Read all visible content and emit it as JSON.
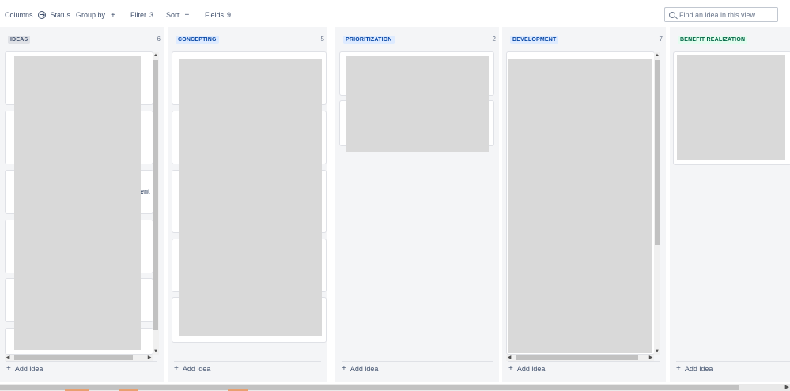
{
  "toolbar": {
    "columns_label": "Columns",
    "columns_value": "Status",
    "group_by_label": "Group by",
    "filter_label": "Filter",
    "filter_count": "3",
    "sort_label": "Sort",
    "fields_label": "Fields",
    "fields_count": "9",
    "search_placeholder": "Find an idea in this view"
  },
  "columns": [
    {
      "name": "IDEAS",
      "count": "6",
      "pill_bg": "#dfe1e6",
      "pill_color": "#42526e",
      "add_label": "Add idea",
      "partial_text": "ent"
    },
    {
      "name": "CONCEPTING",
      "count": "5",
      "pill_bg": "#deebff",
      "pill_color": "#0747a6",
      "add_label": "Add idea"
    },
    {
      "name": "PRIORITIZATION",
      "count": "2",
      "pill_bg": "#deebff",
      "pill_color": "#0747a6",
      "add_label": "Add idea"
    },
    {
      "name": "DEVELOPMENT",
      "count": "7",
      "pill_bg": "#deebff",
      "pill_color": "#0747a6",
      "add_label": "Add idea"
    },
    {
      "name": "BENEFIT REALIZATION",
      "count": "",
      "pill_bg": "#e3fcef",
      "pill_color": "#006644",
      "add_label": "Add idea"
    }
  ],
  "icons": {
    "columns": "circle-arrow-right-icon",
    "add": "plus-icon",
    "search": "search-icon"
  },
  "colors": {
    "board_bg": "#f4f5f7",
    "card_border": "#dfe1e6",
    "redaction": "#d9d9d9"
  }
}
